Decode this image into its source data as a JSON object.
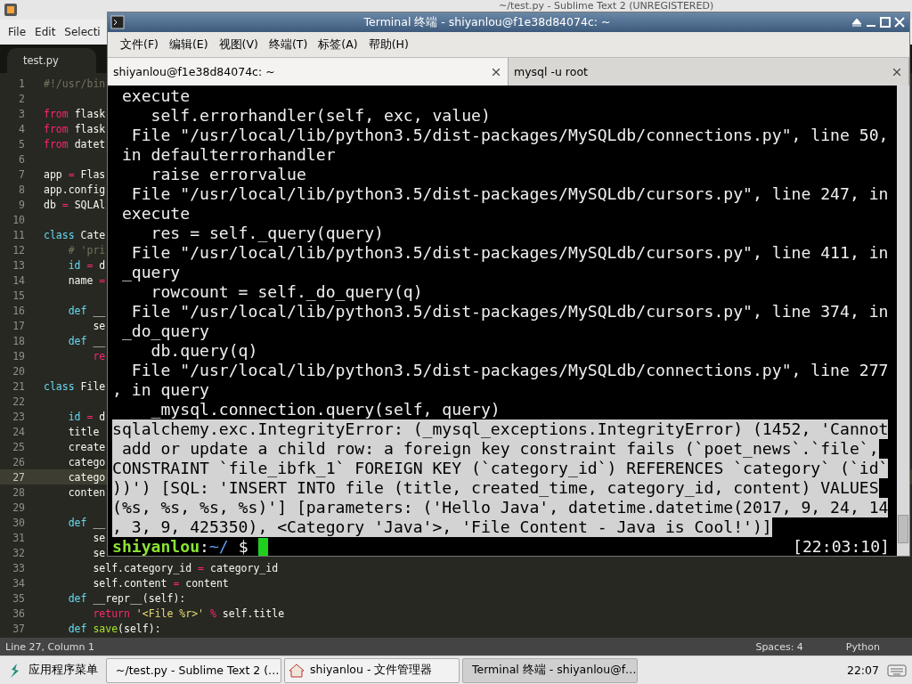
{
  "editor_window": {
    "title": "~/test.py - Sublime Text 2 (UNREGISTERED)",
    "menu": [
      "File",
      "Edit",
      "Selecti"
    ],
    "tabs": [
      {
        "label": "test.py",
        "selected": true
      }
    ],
    "lines": [
      {
        "number": "1",
        "current": false,
        "tokens": [
          {
            "kind": "comment",
            "text": "#!/usr/bin"
          }
        ]
      },
      {
        "number": "2",
        "current": false
      },
      {
        "number": "3",
        "current": false,
        "tokens": [
          {
            "kind": "keyword",
            "text": "from"
          },
          {
            "kind": "plain",
            "text": " flask"
          }
        ]
      },
      {
        "number": "4",
        "current": false,
        "tokens": [
          {
            "kind": "keyword",
            "text": "from"
          },
          {
            "kind": "plain",
            "text": " flask"
          }
        ]
      },
      {
        "number": "5",
        "current": false,
        "tokens": [
          {
            "kind": "keyword",
            "text": "from"
          },
          {
            "kind": "plain",
            "text": " datet"
          }
        ]
      },
      {
        "number": "6",
        "current": false
      },
      {
        "number": "7",
        "current": false,
        "tokens": [
          {
            "kind": "plain",
            "text": "app "
          },
          {
            "kind": "keyword",
            "text": "="
          },
          {
            "kind": "plain",
            "text": " Flas"
          }
        ]
      },
      {
        "number": "8",
        "current": false,
        "tokens": [
          {
            "kind": "plain",
            "text": "app.config"
          }
        ]
      },
      {
        "number": "9",
        "current": false,
        "tokens": [
          {
            "kind": "plain",
            "text": "db "
          },
          {
            "kind": "keyword",
            "text": "="
          },
          {
            "kind": "plain",
            "text": " SQLAl"
          }
        ]
      },
      {
        "number": "10",
        "current": false
      },
      {
        "number": "11",
        "current": false,
        "tokens": [
          {
            "kind": "storage",
            "text": "class"
          },
          {
            "kind": "plain",
            "text": " Cate"
          }
        ]
      },
      {
        "number": "12",
        "current": false,
        "tokens": [
          {
            "kind": "comment",
            "text": "    # 'pri"
          }
        ]
      },
      {
        "number": "13",
        "current": false,
        "tokens": [
          {
            "kind": "storage",
            "text": "    id"
          },
          {
            "kind": "keyword",
            "text": " ="
          },
          {
            "kind": "plain",
            "text": " d"
          }
        ]
      },
      {
        "number": "14",
        "current": false,
        "tokens": [
          {
            "kind": "plain",
            "text": "    name "
          },
          {
            "kind": "keyword",
            "text": "="
          }
        ]
      },
      {
        "number": "15",
        "current": false
      },
      {
        "number": "16",
        "current": false,
        "tokens": [
          {
            "kind": "storage",
            "text": "    def"
          },
          {
            "kind": "plain",
            "text": " __"
          }
        ]
      },
      {
        "number": "17",
        "current": false,
        "tokens": [
          {
            "kind": "plain",
            "text": "        se"
          }
        ]
      },
      {
        "number": "18",
        "current": false,
        "tokens": [
          {
            "kind": "storage",
            "text": "    def"
          },
          {
            "kind": "plain",
            "text": " __"
          }
        ]
      },
      {
        "number": "19",
        "current": false,
        "tokens": [
          {
            "kind": "keyword",
            "text": "        re"
          }
        ]
      },
      {
        "number": "20",
        "current": false
      },
      {
        "number": "21",
        "current": false,
        "tokens": [
          {
            "kind": "storage",
            "text": "class"
          },
          {
            "kind": "plain",
            "text": " File"
          }
        ]
      },
      {
        "number": "22",
        "current": false
      },
      {
        "number": "23",
        "current": false,
        "tokens": [
          {
            "kind": "storage",
            "text": "    id"
          },
          {
            "kind": "keyword",
            "text": " ="
          },
          {
            "kind": "plain",
            "text": " d"
          }
        ]
      },
      {
        "number": "24",
        "current": false,
        "tokens": [
          {
            "kind": "plain",
            "text": "    title"
          }
        ]
      },
      {
        "number": "25",
        "current": false,
        "tokens": [
          {
            "kind": "plain",
            "text": "    create"
          }
        ]
      },
      {
        "number": "26",
        "current": false,
        "tokens": [
          {
            "kind": "plain",
            "text": "    catego"
          }
        ]
      },
      {
        "number": "27",
        "current": true,
        "tokens": [
          {
            "kind": "plain",
            "text": "    catego"
          }
        ]
      },
      {
        "number": "28",
        "current": false,
        "tokens": [
          {
            "kind": "plain",
            "text": "    conten"
          }
        ]
      },
      {
        "number": "29",
        "current": false
      },
      {
        "number": "30",
        "current": false,
        "tokens": [
          {
            "kind": "storage",
            "text": "    def"
          },
          {
            "kind": "plain",
            "text": " __"
          }
        ]
      },
      {
        "number": "31",
        "current": false,
        "tokens": [
          {
            "kind": "plain",
            "text": "        se"
          }
        ]
      },
      {
        "number": "32",
        "current": false,
        "tokens": [
          {
            "kind": "plain",
            "text": "        se"
          }
        ]
      },
      {
        "number": "33",
        "current": false,
        "tokens": [
          {
            "kind": "plain",
            "text": "        self.category_id "
          },
          {
            "kind": "keyword",
            "text": "="
          },
          {
            "kind": "plain",
            "text": " category_id"
          }
        ]
      },
      {
        "number": "34",
        "current": false,
        "tokens": [
          {
            "kind": "plain",
            "text": "        self.content "
          },
          {
            "kind": "keyword",
            "text": "="
          },
          {
            "kind": "plain",
            "text": " content"
          }
        ]
      },
      {
        "number": "35",
        "current": false,
        "tokens": [
          {
            "kind": "storage",
            "text": "    def"
          },
          {
            "kind": "plain",
            "text": " __repr__(self):"
          }
        ]
      },
      {
        "number": "36",
        "current": false,
        "tokens": [
          {
            "kind": "keyword",
            "text": "        return"
          },
          {
            "kind": "string",
            "text": " '<File %r>'"
          },
          {
            "kind": "keyword",
            "text": " %"
          },
          {
            "kind": "plain",
            "text": " self.title"
          }
        ]
      },
      {
        "number": "37",
        "current": false,
        "tokens": [
          {
            "kind": "storage",
            "text": "    def"
          },
          {
            "kind": "function",
            "text": " save"
          },
          {
            "kind": "plain",
            "text": "(self):"
          }
        ]
      }
    ],
    "status_bar": {
      "position": "Line 27, Column 1",
      "indentation": "Spaces: 4",
      "syntax": "Python"
    }
  },
  "terminal_window": {
    "title": "Terminal 终端 - shiyanlou@f1e38d84074c: ~",
    "menu": [
      "文件(F)",
      "编辑(E)",
      "视图(V)",
      "终端(T)",
      "标签(A)",
      "帮助(H)"
    ],
    "tabs": [
      {
        "label": "shiyanlou@f1e38d84074c: ~",
        "selected": true
      },
      {
        "label": "mysql -u root",
        "selected": false
      }
    ],
    "output": [
      {
        "text": " execute",
        "selected": false
      },
      {
        "text": "    self.errorhandler(self, exc, value)",
        "selected": false
      },
      {
        "text": "  File \"/usr/local/lib/python3.5/dist-packages/MySQLdb/connections.py\", line 50,",
        "selected": false
      },
      {
        "text": " in defaulterrorhandler",
        "selected": false
      },
      {
        "text": "    raise errorvalue",
        "selected": false
      },
      {
        "text": "  File \"/usr/local/lib/python3.5/dist-packages/MySQLdb/cursors.py\", line 247, in",
        "selected": false
      },
      {
        "text": " execute",
        "selected": false
      },
      {
        "text": "    res = self._query(query)",
        "selected": false
      },
      {
        "text": "  File \"/usr/local/lib/python3.5/dist-packages/MySQLdb/cursors.py\", line 411, in",
        "selected": false
      },
      {
        "text": " _query",
        "selected": false
      },
      {
        "text": "    rowcount = self._do_query(q)",
        "selected": false
      },
      {
        "text": "  File \"/usr/local/lib/python3.5/dist-packages/MySQLdb/cursors.py\", line 374, in",
        "selected": false
      },
      {
        "text": " _do_query",
        "selected": false
      },
      {
        "text": "    db.query(q)",
        "selected": false
      },
      {
        "text": "  File \"/usr/local/lib/python3.5/dist-packages/MySQLdb/connections.py\", line 277",
        "selected": false
      },
      {
        "text": ", in query",
        "selected": false
      },
      {
        "text": "    _mysql.connection.query(self, query)",
        "selected": false
      },
      {
        "text": "sqlalchemy.exc.IntegrityError: (_mysql_exceptions.IntegrityError) (1452, 'Cannot",
        "selected": true
      },
      {
        "text": " add or update a child row: a foreign key constraint fails (`poet_news`.`file`,",
        "selected": true
      },
      {
        "text": "CONSTRAINT `file_ibfk_1` FOREIGN KEY (`category_id`) REFERENCES `category` (`id`",
        "selected": true
      },
      {
        "text": "))') [SQL: 'INSERT INTO file (title, created_time, category_id, content) VALUES",
        "selected": true
      },
      {
        "text": "(%s, %s, %s, %s)'] [parameters: ('Hello Java', datetime.datetime(2017, 9, 24, 14",
        "selected": true
      },
      {
        "text": ", 3, 9, 425350), <Category 'Java'>, 'File Content - Java is Cool!')]",
        "selected": true
      }
    ],
    "prompt": {
      "user": "shiyanlou",
      "separator": ":",
      "path": "~/",
      "symbol": " $",
      "time": "[22:03:10]"
    }
  },
  "taskbar": {
    "start_menu": "应用程序菜单",
    "tasks": [
      {
        "kind": "editor",
        "label": "~/test.py - Sublime Text 2 (…",
        "selected": false
      },
      {
        "kind": "files",
        "label": "shiyanlou - 文件管理器",
        "selected": false
      },
      {
        "kind": "terminal",
        "label": "Terminal 终端 - shiyanlou@f…",
        "selected": true
      }
    ],
    "clock": "22:07"
  }
}
